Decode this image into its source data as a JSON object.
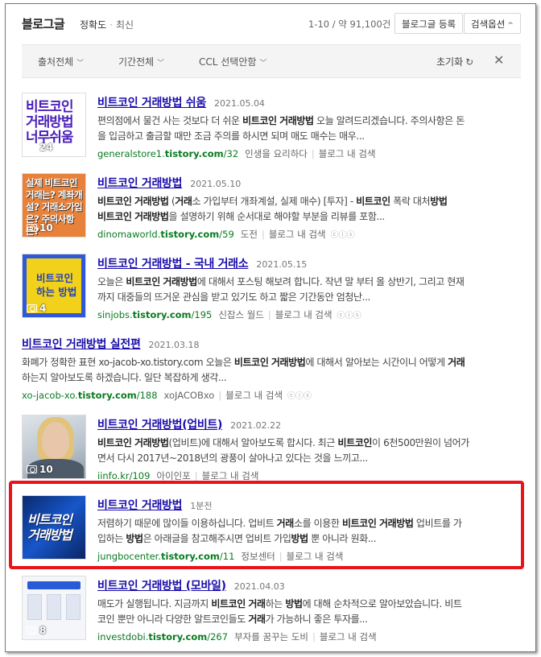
{
  "header": {
    "title": "블로그글",
    "sort_accuracy": "정확도",
    "sort_recent": "최신",
    "count": "1-10 / 약 91,100건",
    "register_button": "블로그글 등록",
    "options_button": "검색옵션"
  },
  "filters": {
    "source": "출처전체",
    "period": "기간전체",
    "ccl": "CCL 선택안함",
    "reset": "초기화"
  },
  "results": [
    {
      "title": "비트코인 거래방법 쉬움",
      "date": "2021.05.04",
      "desc_line1": "편의점에서 물건 사는 것보다 더 쉬운 비트코인 거래방법 오늘 알려드리겠습니다. 주의사항은 돈",
      "desc_line2": "을 입금하고 출금할 때만 조금 주의를 하시면 되며 매도 매수는 매우...",
      "url_prefix": "generalstore1.",
      "url_bold": "tistory.com",
      "url_suffix": "/32",
      "author": "인생을 요리하다",
      "in_blog": "블로그 내 검색",
      "thumb_text": "비트코인 거래방법 너무쉬움",
      "thumb_count": "24"
    },
    {
      "title": "비트코인 거래방법",
      "date": "2021.05.10",
      "desc_line1": "비트코인 거래방법 (거래소 가입부터 개좌계설, 실제 매수) [투자] - 비트코인 폭락 대처방법",
      "desc_line2": "비트코인 거래방법을 설명하기 위해 순서대로 해야할 부분을 리뷰를 포함...",
      "url_prefix": "dinomaworld.",
      "url_bold": "tistory.com",
      "url_suffix": "/59",
      "author": "도전",
      "in_blog": "블로그 내 검색",
      "thumb_text": "실제 비트코인 거래는? 계좌개설? 거래소가입은? 주의사항은?",
      "thumb_count": "10"
    },
    {
      "title": "비트코인 거래방법 - 국내 거래소",
      "date": "2021.05.15",
      "desc_line1": "오늘은 비트코인 거래방법에 대해서 포스팅 해보려 합니다. 작년 말 부터 올 상반기, 그리고 현재",
      "desc_line2": "까지 대중들의 뜨거운 관심을 받고 있기도 하고 짧은 기간동안 엄청난...",
      "url_prefix": "sinjobs.",
      "url_bold": "tistory.com",
      "url_suffix": "/195",
      "author": "신잡스 월드",
      "in_blog": "블로그 내 검색",
      "thumb_text": "비트코인 하는 방법",
      "thumb_count": "4"
    },
    {
      "title": "비트코인 거래방법 실전편",
      "date": "2021.03.18",
      "desc_line1": "화폐가 정확한 표현 xo-jacob-xo.tistory.com 오늘은 비트코인 거래방법에 대해서 알아보는 시간이니 어떻게 거래",
      "desc_line2": "하는지 알아보도록 하겠습니다. 일단 복잡하게 생각...",
      "url_prefix": "xo-jacob-xo.",
      "url_bold": "tistory.com",
      "url_suffix": "/188",
      "author": "xoJACOBxo",
      "in_blog": "블로그 내 검색"
    },
    {
      "title": "비트코인 거래방법(업비트)",
      "date": "2021.02.22",
      "desc_line1": "비트코인 거래방법(업비트)에 대해서 알아보도록 합시다. 최근 비트코인이 6천500만원이 넘어가",
      "desc_line2": "면서 다시 2017년~2018년의 광풍이 살아나고 있다는 것을 느끼고...",
      "url_prefix": "iinfo.kr",
      "url_bold": "",
      "url_suffix": "/109",
      "author": "아이인포",
      "in_blog": "블로그 내 검색",
      "thumb_count": "10"
    },
    {
      "title": "비트코인 거래방법",
      "date": "1분전",
      "desc_line1": "저렴하기 때문에 많이들 이용하십니다. 업비트 거래소를 이용한 비트코인 거래방법 업비트를 가",
      "desc_line2": "입하는 방법은 아래글을 참고해주시면 업비트 가입방법 뿐 아니라 원화...",
      "url_prefix": "jungbocenter.",
      "url_bold": "tistory.com",
      "url_suffix": "/11",
      "author": "정보센터",
      "in_blog": "블로그 내 검색",
      "thumb_text": "비트코인 거래방법"
    },
    {
      "title": "비트코인 거래방법 (모바일)",
      "date": "2021.04.03",
      "desc_line1": "매도가 실행됩니다. 지금까지 비트코인 거래하는 방법에 대해 순차적으로 알아보았습니다. 비트",
      "desc_line2": "코인 뿐만 아니라 다양한 알트코인들도 거래가 가능하니 좋은 투자를...",
      "url_prefix": "investdobi.",
      "url_bold": "tistory.com",
      "url_suffix": "/267",
      "author": "부자를 꿈꾸는 도비",
      "in_blog": "블로그 내 검색",
      "thumb_count": "8"
    }
  ],
  "colors": {
    "link": "#1a0dab",
    "url": "#0a7b22",
    "highlight_border": "#e8141a"
  }
}
